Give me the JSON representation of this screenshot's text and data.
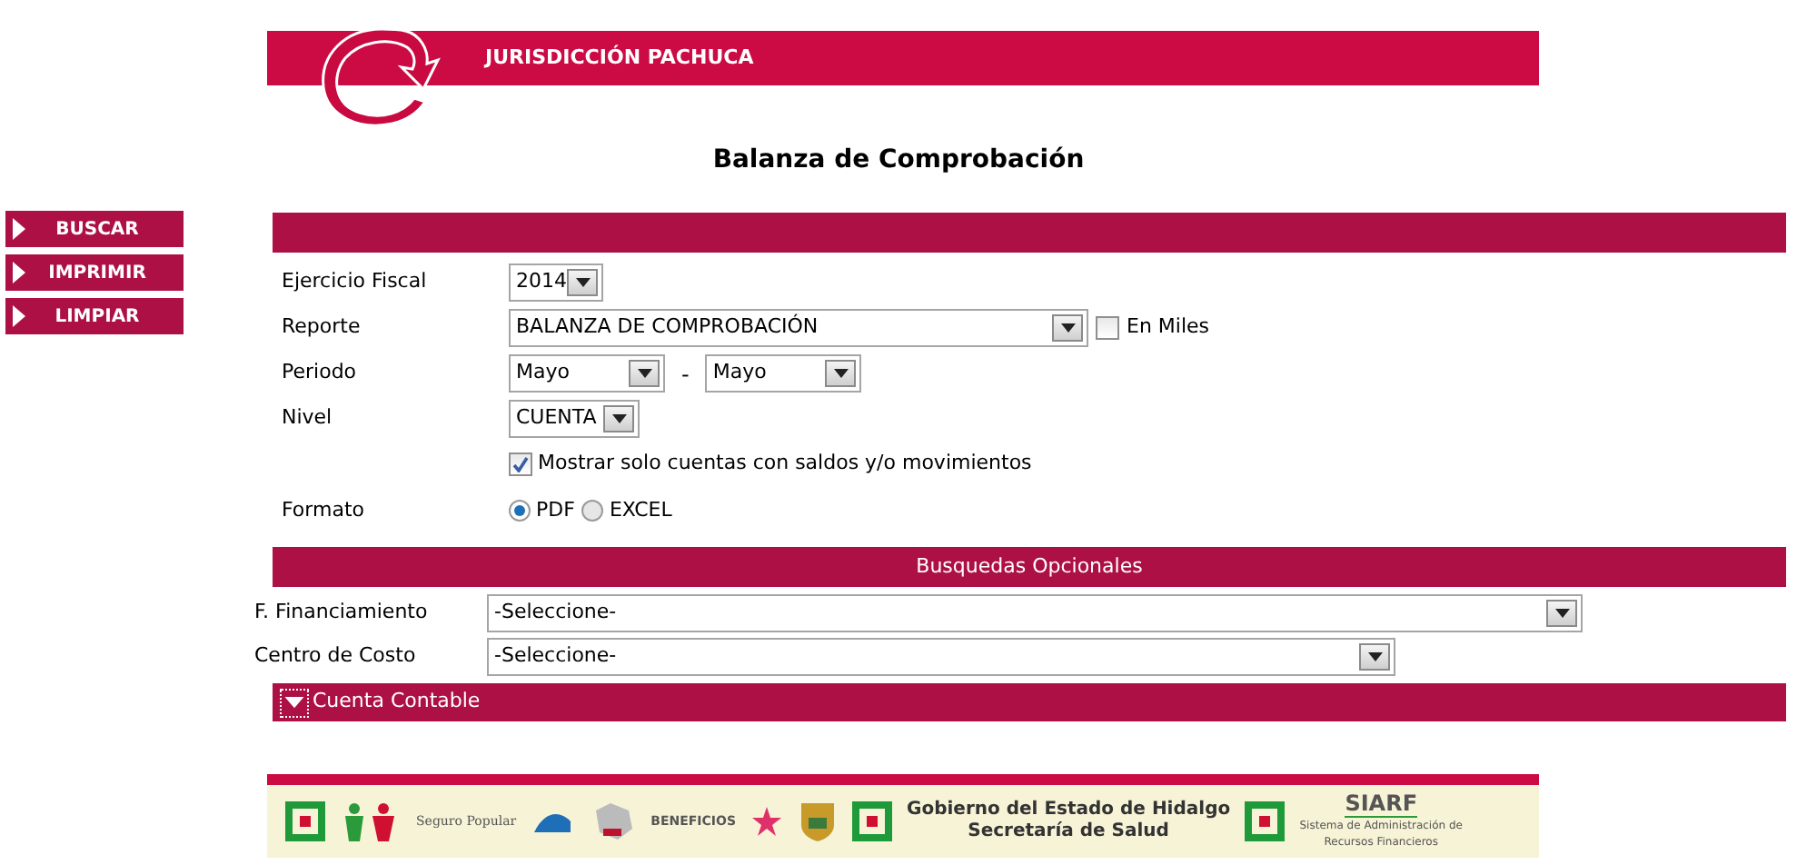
{
  "header": {
    "title": "JURISDICCIÓN PACHUCA"
  },
  "page_title": "Balanza de Comprobación",
  "actions": [
    {
      "label": "BUSCAR"
    },
    {
      "label": "IMPRIMIR"
    },
    {
      "label": "LIMPIAR"
    }
  ],
  "form": {
    "ejercicio": {
      "label": "Ejercicio Fiscal",
      "value": "2014"
    },
    "reporte": {
      "label": "Reporte",
      "value": "BALANZA DE COMPROBACIÓN",
      "en_miles": {
        "label": "En Miles",
        "checked": false
      }
    },
    "periodo": {
      "label": "Periodo",
      "from": "Mayo",
      "separator": "-",
      "to": "Mayo"
    },
    "nivel": {
      "label": "Nivel",
      "value": "CUENTA"
    },
    "mostrar": {
      "label": "Mostrar solo cuentas con saldos y/o movimientos",
      "checked": true
    },
    "formato": {
      "label": "Formato",
      "options": [
        {
          "label": "PDF",
          "selected": true
        },
        {
          "label": "EXCEL",
          "selected": false
        }
      ]
    }
  },
  "optional": {
    "title": "Busquedas Opcionales",
    "fields": [
      {
        "label": "F. Financiamiento",
        "value": "-Seleccione-"
      },
      {
        "label": "Centro de Costo",
        "value": "-Seleccione-"
      }
    ],
    "cuenta_contable": {
      "label": "Cuenta Contable",
      "expanded": false
    }
  },
  "footer": {
    "seguro_popular": "Seguro Popular",
    "beneficios": "BENEFICIOS",
    "gobierno": "Gobierno del Estado de Hidalgo",
    "secretaria": "Secretaría de Salud",
    "siarf": "SIARF",
    "siarf_sub": "Sistema de Administración de Recursos Financieros"
  }
}
